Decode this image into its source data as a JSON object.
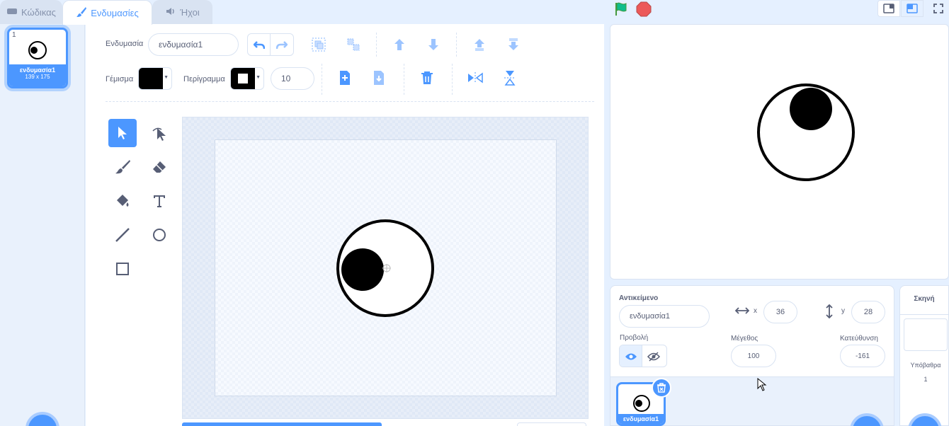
{
  "tabs": [
    {
      "label": "Κώδικας",
      "icon": "code-icon",
      "active": false
    },
    {
      "label": "Ενδυμασίες",
      "icon": "brush-icon",
      "active": true
    },
    {
      "label": "Ήχοι",
      "icon": "speaker-icon",
      "active": false
    }
  ],
  "costume_list": {
    "items": [
      {
        "number": "1",
        "name": "ενδυμασία1",
        "size": "139 x 175"
      }
    ]
  },
  "editor": {
    "costume_label": "Ενδυμασία",
    "costume_name": "ενδυμασία1",
    "fill_label": "Γέμισμα",
    "outline_label": "Περίγραμμα",
    "outline_width": "10",
    "fill_color": "#000000",
    "outline_color": "#000000"
  },
  "sprite_info": {
    "sprite_label": "Αντικείμενο",
    "sprite_name": "ενδυμασία1",
    "x_label": "x",
    "x_value": "36",
    "y_label": "y",
    "y_value": "28",
    "show_label": "Προβολή",
    "size_label": "Μέγεθος",
    "size_value": "100",
    "direction_label": "Κατεύθυνση",
    "direction_value": "-161"
  },
  "sprites": [
    {
      "name": "ενδυμασία1"
    }
  ],
  "stage_pane": {
    "title": "Σκηνή",
    "backdrops_label": "Υπόβαθρα",
    "backdrops_count": "1"
  },
  "colors": {
    "accent": "#4c97ff",
    "green_flag": "#0fbd8c",
    "stop": "#ec5959"
  }
}
